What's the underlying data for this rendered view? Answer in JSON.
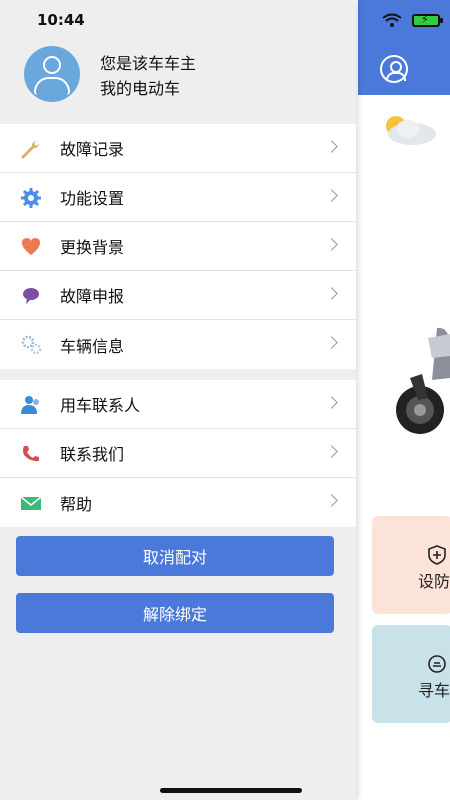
{
  "status_bar": {
    "time": "10:44"
  },
  "profile": {
    "line1": "您是该车车主",
    "line2": "我的电动车"
  },
  "menu_group1": [
    {
      "label": "故障记录",
      "icon": "wrench-icon",
      "color": "#e0b15a"
    },
    {
      "label": "功能设置",
      "icon": "gear-icon",
      "color": "#4a8ee6"
    },
    {
      "label": "更换背景",
      "icon": "heart-icon",
      "color": "#ea7a52"
    },
    {
      "label": "故障申报",
      "icon": "chat-bubble-icon",
      "color": "#7b4fa3"
    },
    {
      "label": "车辆信息",
      "icon": "gears-icon",
      "color": "#9ab7d8"
    }
  ],
  "menu_group2": [
    {
      "label": "用车联系人",
      "icon": "contacts-icon",
      "color": "#3a8ad6"
    },
    {
      "label": "联系我们",
      "icon": "phone-icon",
      "color": "#d94a4a"
    },
    {
      "label": "帮助",
      "icon": "mail-icon",
      "color": "#3cb878"
    }
  ],
  "buttons": {
    "cancel_pair": "取消配对",
    "unbind": "解除绑定"
  },
  "background_app": {
    "card1_label": "设防",
    "card2_label": "寻车",
    "accent": "#4a79d9"
  }
}
